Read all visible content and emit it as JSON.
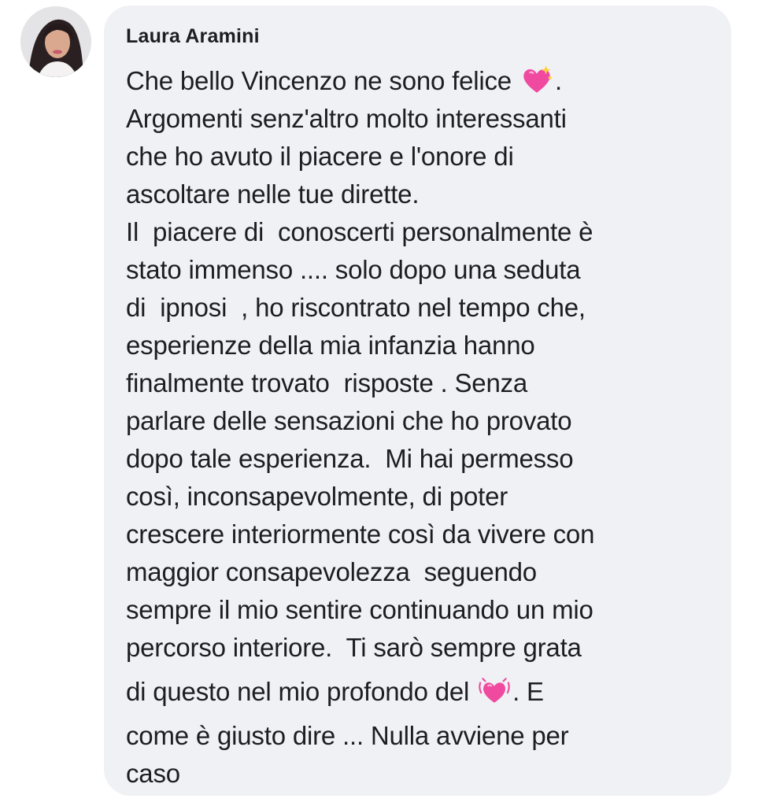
{
  "author": {
    "name": "Laura Aramini",
    "avatar_icon": "profile-photo"
  },
  "comment": {
    "lines": [
      "Che bello Vincenzo ne sono felice",
      "Argomenti senz'altro molto interessanti",
      "che ho avuto il piacere e l'onore di",
      "ascoltare nelle tue dirette.",
      "Il  piacere di  conoscerti personalmente è",
      "stato immenso .... solo dopo una seduta",
      "di  ipnosi  , ho riscontrato nel tempo che,",
      "esperienze della mia infanzia hanno",
      "finalmente trovato  risposte . Senza",
      "parlare delle sensazioni che ho provato",
      "dopo tale esperienza.  Mi hai permesso",
      "così, inconsapevolmente, di poter",
      "crescere interiormente così da vivere con",
      "maggior consapevolezza  seguendo",
      "sempre il mio sentire continuando un mio",
      "percorso interiore.  Ti sarò sempre grata",
      "di questo nel mio profondo del",
      "come è giusto dire ... Nulla avviene per",
      "caso"
    ],
    "line1_suffix": ".",
    "line17_suffix": ". E",
    "emoji_1": "sparkling-heart",
    "emoji_2": "beating-heart"
  },
  "colors": {
    "bubble": "#f0f1f4",
    "text": "#1c1e21",
    "heart": "#f04aa0"
  }
}
